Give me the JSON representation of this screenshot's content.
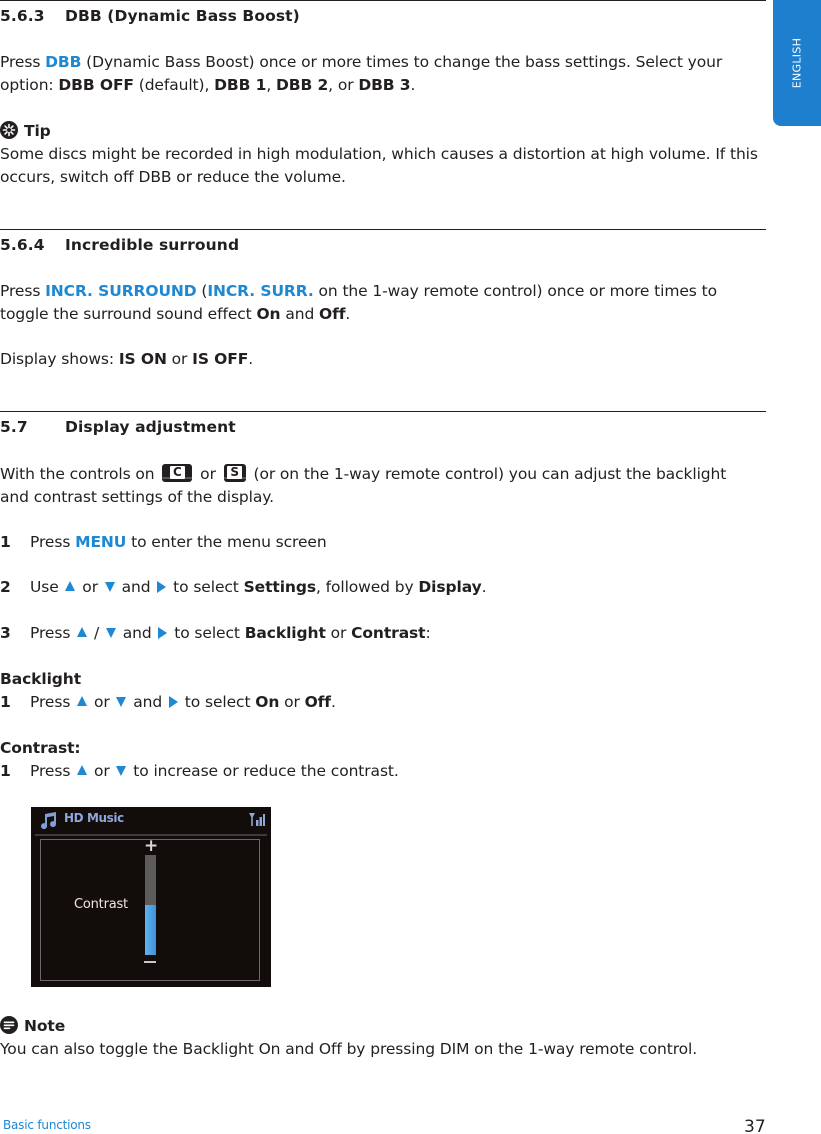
{
  "side_tab": {
    "label": "ENGLISH"
  },
  "sections": {
    "dbb": {
      "number": "5.6.3",
      "title": "DBB (Dynamic Bass Boost)",
      "line1": {
        "pre": "Press ",
        "key": "DBB",
        "post": " (Dynamic Bass Boost) once or more times to change the bass settings. Select your"
      },
      "line2": {
        "pre": "option: ",
        "o1": "DBB OFF",
        "mid1": " (default), ",
        "o2": "DBB 1",
        "mid2": ", ",
        "o3": "DBB 2",
        "mid3": ", or ",
        "o4": "DBB 3",
        "end": "."
      },
      "tip": {
        "label": "Tip",
        "line1": "Some discs might be recorded in high modulation, which causes a distortion at high volume. If this",
        "line2": "occurs, switch off DBB or reduce the volume."
      }
    },
    "surround": {
      "number": "5.6.4",
      "title": "Incredible surround",
      "line1": {
        "pre": "Press ",
        "k1": "INCR. SURROUND",
        "mid": " (",
        "k2": "INCR. SURR.",
        "post": " on the 1-way remote control) once or more times to"
      },
      "line2": {
        "pre": "toggle the surround sound effect ",
        "on": "On",
        "mid": " and ",
        "off": "Off",
        "end": "."
      },
      "line3": {
        "pre": "Display shows: ",
        "s1": "IS ON",
        "mid": " or ",
        "s2": "IS OFF",
        "end": "."
      }
    },
    "display": {
      "number": "5.7",
      "title": "Display adjustment",
      "intro1": {
        "pre": "With the controls on ",
        "key_c": "C",
        "mid": " or ",
        "key_s": "S",
        "post": " (or on the 1-way remote control) you can adjust the backlight"
      },
      "intro2": "and contrast settings of the display.",
      "steps": [
        {
          "n": "1",
          "pre": "Press ",
          "key": "MENU",
          "post": " to enter the menu screen"
        },
        {
          "n": "2",
          "pre": "Use ",
          "or": " or ",
          "and": " and ",
          "mid": " to select ",
          "b1": "Settings",
          "fb": ", followed by ",
          "b2": "Display",
          "end": "."
        },
        {
          "n": "3",
          "pre": "Press ",
          "slash": " / ",
          "and": " and ",
          "mid": " to select ",
          "b1": "Backlight",
          "or": " or ",
          "b2": "Contrast",
          "end": ":"
        }
      ],
      "backlight": {
        "heading": "Backlight",
        "step": {
          "n": "1",
          "pre": "Press ",
          "or": " or ",
          "and": " and ",
          "mid": " to select ",
          "b1": "On",
          "or2": " or ",
          "b2": "Off",
          "end": "."
        }
      },
      "contrast": {
        "heading": "Contrast:",
        "step": {
          "n": "1",
          "pre": "Press ",
          "or": " or ",
          "post": " to increase or reduce the contrast."
        }
      },
      "screen": {
        "title": "HD Music",
        "label": "Contrast",
        "level_fraction": 0.5
      },
      "note": {
        "label": "Note",
        "text": "You can also toggle the Backlight On and Off by pressing DIM on the 1-way remote control."
      }
    }
  },
  "footer": {
    "section": "Basic functions",
    "page": "37"
  }
}
